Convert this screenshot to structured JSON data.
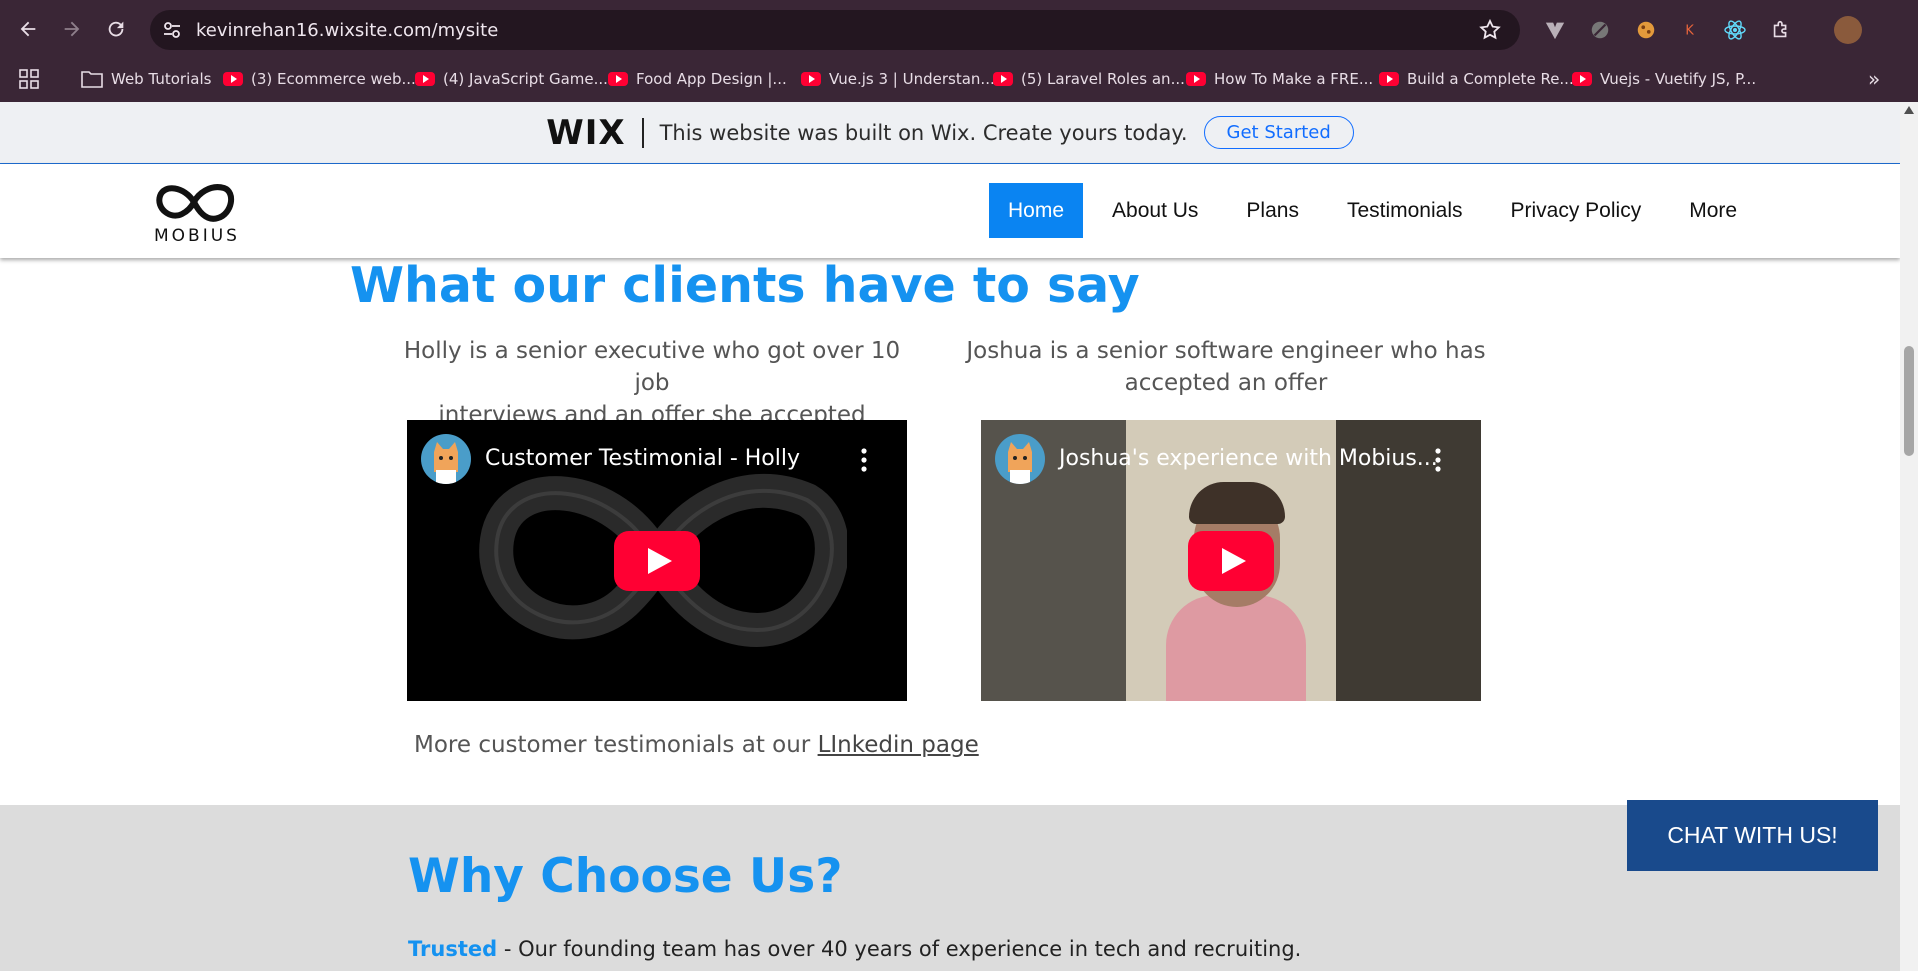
{
  "browser": {
    "url": "kevinrehan16.wixsite.com/mysite",
    "bookmarks": [
      {
        "label": "Web Tutorials",
        "icon": "folder-icon"
      },
      {
        "label": "(3) Ecommerce web...",
        "icon": "youtube-icon"
      },
      {
        "label": "(4) JavaScript Game...",
        "icon": "youtube-icon"
      },
      {
        "label": "Food App Design |...",
        "icon": "youtube-icon"
      },
      {
        "label": "Vue.js 3 | Understan...",
        "icon": "youtube-icon"
      },
      {
        "label": "(5) Laravel Roles an...",
        "icon": "youtube-icon"
      },
      {
        "label": "How To Make a FRE...",
        "icon": "youtube-icon"
      },
      {
        "label": "Build a Complete Re...",
        "icon": "youtube-icon"
      },
      {
        "label": "Vuejs - Vuetify JS, P...",
        "icon": "youtube-icon"
      }
    ],
    "more_bookmarks": "»"
  },
  "wix_banner": {
    "logo": "WIX",
    "text": "This website was built on Wix. Create yours today.",
    "button": "Get Started"
  },
  "header": {
    "logo_text": "MOBIUS",
    "nav": [
      "Home",
      "About Us",
      "Plans",
      "Testimonials",
      "Privacy Policy",
      "More"
    ],
    "active": "Home"
  },
  "testimonials": {
    "title": "What our clients have to say",
    "items": [
      {
        "caption_line1": "Holly is a senior executive who got over 10 job",
        "caption_line2": "interviews and an offer she accepted",
        "video_title": "Customer Testimonial - Holly"
      },
      {
        "caption_line1": "Joshua is a senior software engineer who has",
        "caption_line2": "accepted an offer",
        "video_title": "Joshua's experience with Mobius..."
      }
    ],
    "more_prefix": "More customer testimonials at our ",
    "more_link": "LInkedin page"
  },
  "why": {
    "title": "Why Choose Us?",
    "trusted_label": "Trusted",
    "trusted_text": " - Our founding team has over 40 years of experience in tech and recruiting."
  },
  "chat_button": "CHAT WITH US!",
  "colors": {
    "accent": "#1592f0",
    "nav_active": "#0a84f2",
    "chat": "#194a8c",
    "youtube_red": "#ff0033",
    "chrome": "#3a2636"
  }
}
